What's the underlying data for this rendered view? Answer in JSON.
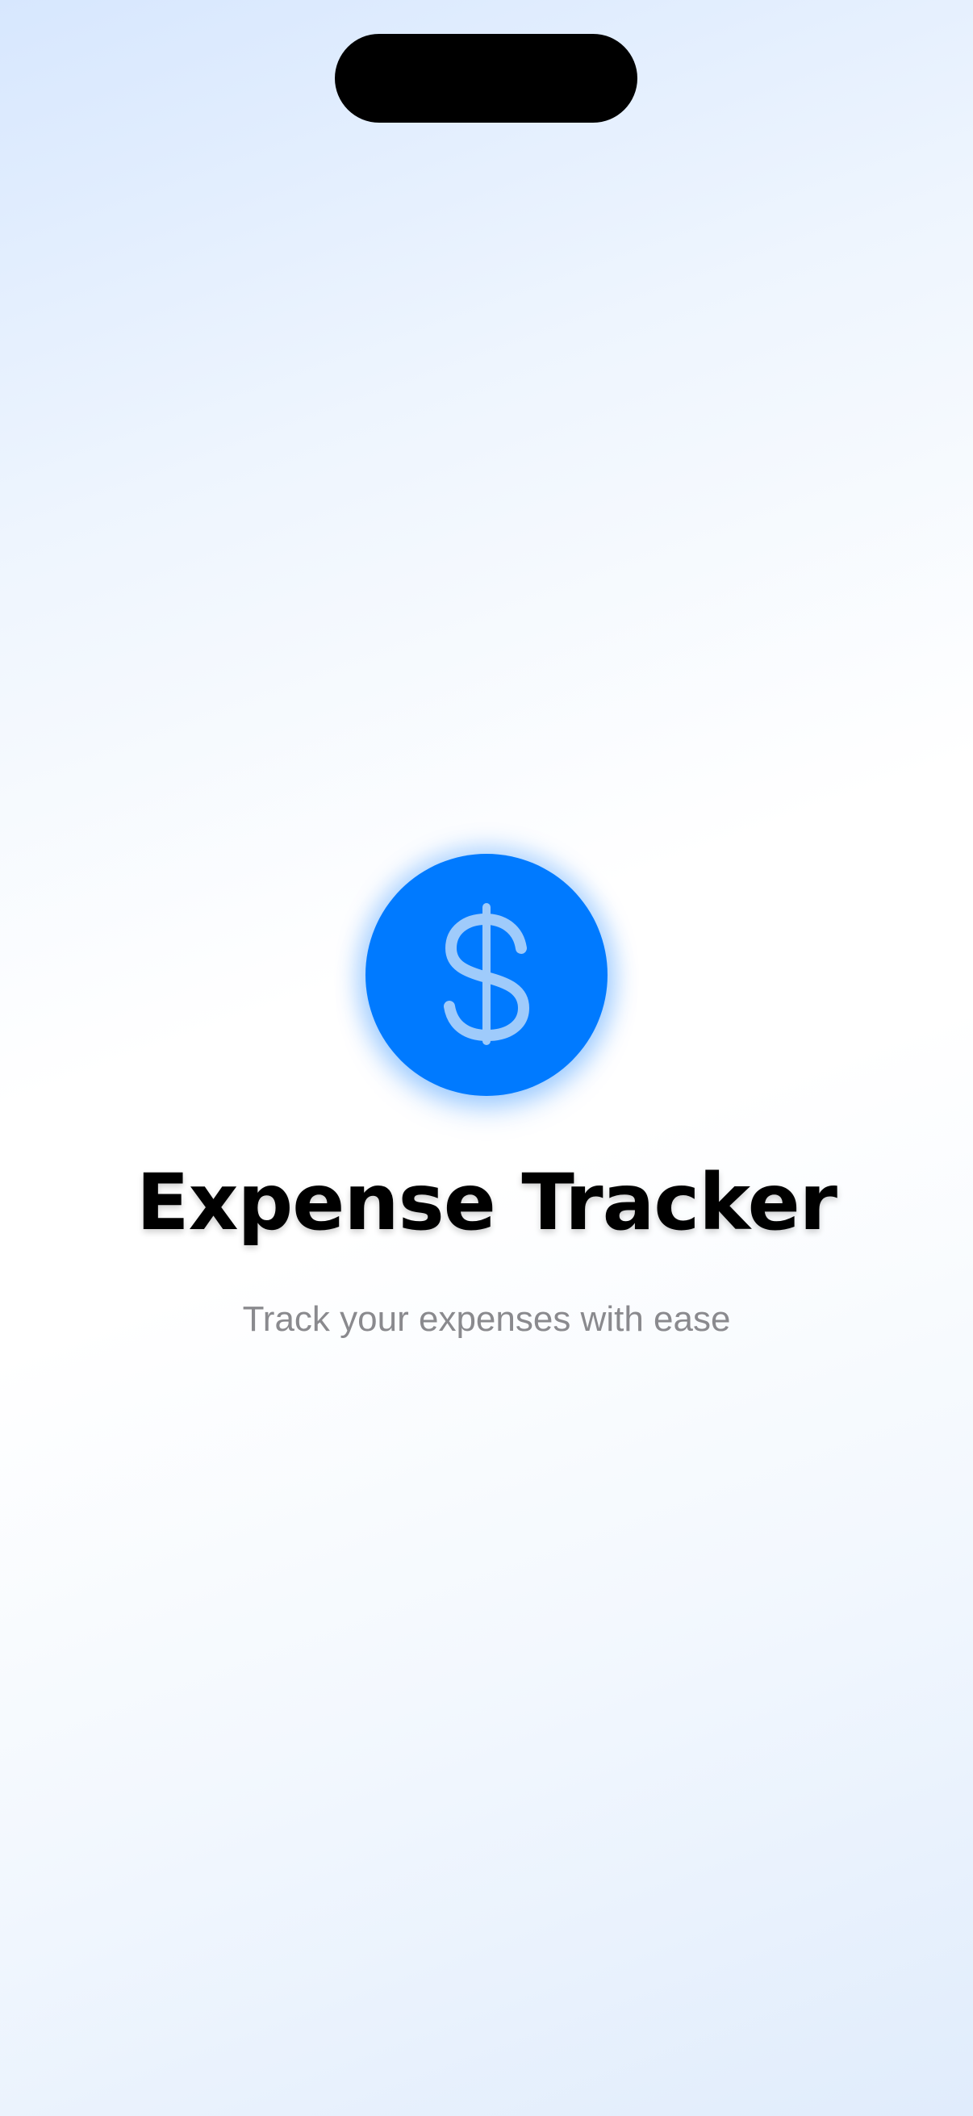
{
  "app": {
    "title": "Expense Tracker",
    "subtitle": "Track your expenses with ease",
    "logo_icon": "dollar-sign-icon"
  },
  "colors": {
    "accent": "#007aff",
    "title_text": "#000000",
    "subtitle_text": "#8a8a8e",
    "icon_glyph": "#9fcbfb",
    "island": "#000000"
  }
}
